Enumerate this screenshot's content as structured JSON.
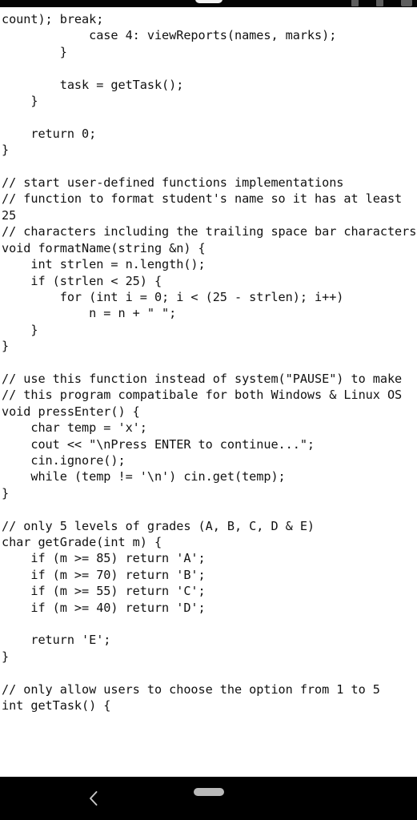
{
  "status_bar": {
    "background_color": "#050505",
    "notch": "camera-cutout",
    "icons": [
      "signal-icon",
      "wifi-icon",
      "battery-icon"
    ]
  },
  "editor": {
    "background_color": "#ffffff",
    "text_color": "#111111",
    "language": "cpp",
    "content": "count); break;\n            case 4: viewReports(names, marks);\n        }\n\n        task = getTask();\n    }\n\n    return 0;\n}\n\n// start user-defined functions implementations\n// function to format student's name so it has at least 25\n// characters including the trailing space bar characters\nvoid formatName(string &n) {\n    int strlen = n.length();\n    if (strlen < 25) {\n        for (int i = 0; i < (25 - strlen); i++)\n            n = n + \" \";\n    }\n}\n\n// use this function instead of system(\"PAUSE\") to make\n// this program compatibale for both Windows & Linux OS\nvoid pressEnter() {\n    char temp = 'x';\n    cout << \"\\nPress ENTER to continue...\";\n    cin.ignore();\n    while (temp != '\\n') cin.get(temp);\n}\n\n// only 5 levels of grades (A, B, C, D & E)\nchar getGrade(int m) {\n    if (m >= 85) return 'A';\n    if (m >= 70) return 'B';\n    if (m >= 55) return 'C';\n    if (m >= 40) return 'D';\n\n    return 'E';\n}\n\n// only allow users to choose the option from 1 to 5\nint getTask() {"
  },
  "nav_bar": {
    "background_color": "#000000",
    "back_label": "Back",
    "home_label": "Home",
    "icons": [
      "chevron-left-icon",
      "home-pill-indicator"
    ]
  }
}
